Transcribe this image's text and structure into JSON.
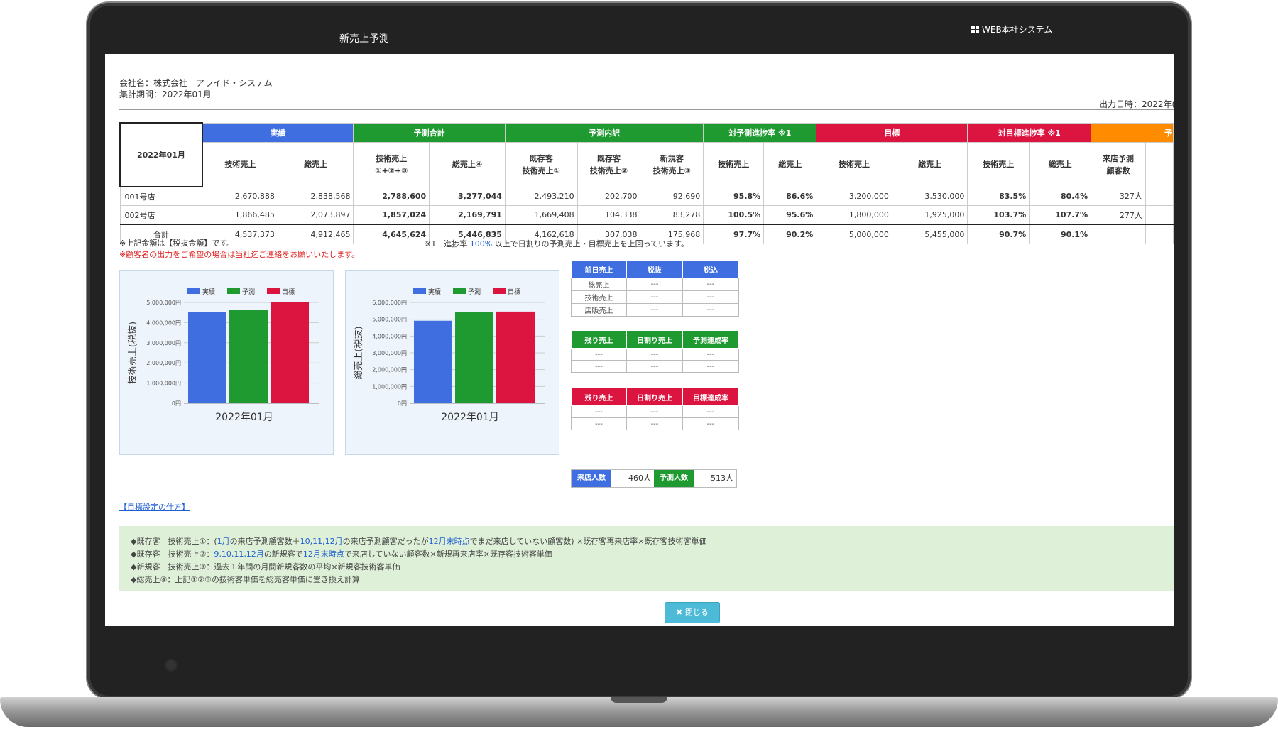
{
  "window": {
    "title": "新売上予測",
    "brand": "WEB本社システム"
  },
  "header": {
    "company": "会社名：株式会社　アライド・システム",
    "period": "集計期間：2022年01月",
    "output_date": "出力日時：2022年("
  },
  "table": {
    "corner": "2022年01月",
    "groups": {
      "actual": "実績",
      "forecast_total": "予測合計",
      "forecast_breakdown": "予測内訳",
      "forecast_progress": "対予測進捗率 ※1",
      "target": "目標",
      "target_progress": "対目標進捗率 ※1",
      "cut": "予"
    },
    "subheaders": {
      "actual_tech": "技術売上",
      "actual_total": "総売上",
      "fc_tech_l1": "技術売上",
      "fc_tech_l2": "①+②+③",
      "fc_total": "総売上④",
      "ex1_l1": "既存客",
      "ex1_l2": "技術売上①",
      "ex2_l1": "既存客",
      "ex2_l2": "技術売上②",
      "new_l1": "新規客",
      "new_l2": "技術売上③",
      "fp_tech": "技術売上",
      "fp_total": "総売上",
      "tg_tech": "技術売上",
      "tg_total": "総売上",
      "tp_tech": "技術売上",
      "tp_total": "総売上",
      "visit_l1": "来店予測",
      "visit_l2": "顧客数"
    },
    "rows": [
      {
        "name": "001号店",
        "a_tech": "2,670,888",
        "a_total": "2,838,568",
        "f_tech": "2,788,600",
        "f_total": "3,277,044",
        "ex1": "2,493,210",
        "ex2": "202,700",
        "new": "92,690",
        "fp_tech": "95.8%",
        "fp_total": "86.6%",
        "t_tech": "3,200,000",
        "t_total": "3,530,000",
        "tp_tech": "83.5%",
        "tp_total": "80.4%",
        "visit": "327人"
      },
      {
        "name": "002号店",
        "a_tech": "1,866,485",
        "a_total": "2,073,897",
        "f_tech": "1,857,024",
        "f_total": "2,169,791",
        "ex1": "1,669,408",
        "ex2": "104,338",
        "new": "83,278",
        "fp_tech": "100.5%",
        "fp_total": "95.6%",
        "t_tech": "1,800,000",
        "t_total": "1,925,000",
        "tp_tech": "103.7%",
        "tp_total": "107.7%",
        "visit": "277人"
      }
    ],
    "total": {
      "name": "合計",
      "a_tech": "4,537,373",
      "a_total": "4,912,465",
      "f_tech": "4,645,624",
      "f_total": "5,446,835",
      "ex1": "4,162,618",
      "ex2": "307,038",
      "new": "175,968",
      "fp_tech": "97.7%",
      "fp_total": "90.2%",
      "t_tech": "5,000,000",
      "t_total": "5,455,000",
      "tp_tech": "90.7%",
      "tp_total": "90.1%",
      "visit": ""
    }
  },
  "notes": {
    "tax": "※上記金額は【税抜金額】です。",
    "customer": "※顧客名の出力をご希望の場合は当社迄ご連絡をお願いいたします。",
    "progress_prefix": "※1　進捗率",
    "progress_pct": "100%",
    "progress_suffix": "以上で日割りの予測売上・目標売上を上回っています。"
  },
  "chart_data": [
    {
      "type": "bar",
      "title": "",
      "ylabel": "技術売上(税抜)",
      "xlabel": "2022年01月",
      "categories": [
        "2022年01月"
      ],
      "ylim": [
        0,
        5000000
      ],
      "yticks": [
        "0円",
        "1,000,000円",
        "2,000,000円",
        "3,000,000円",
        "4,000,000円",
        "5,000,000円"
      ],
      "legend_position": "top",
      "series": [
        {
          "name": "実績",
          "values": [
            4537373
          ],
          "color": "#3f6ee0"
        },
        {
          "name": "予測",
          "values": [
            4645624
          ],
          "color": "#1e9a30"
        },
        {
          "name": "目標",
          "values": [
            5000000
          ],
          "color": "#dc1440"
        }
      ]
    },
    {
      "type": "bar",
      "title": "",
      "ylabel": "総売上(税抜)",
      "xlabel": "2022年01月",
      "categories": [
        "2022年01月"
      ],
      "ylim": [
        0,
        6000000
      ],
      "yticks": [
        "0円",
        "1,000,000円",
        "2,000,000円",
        "3,000,000円",
        "4,000,000円",
        "5,000,000円",
        "6,000,000円"
      ],
      "legend_position": "top",
      "series": [
        {
          "name": "実績",
          "values": [
            4912465
          ],
          "color": "#3f6ee0"
        },
        {
          "name": "予測",
          "values": [
            5446835
          ],
          "color": "#1e9a30"
        },
        {
          "name": "目標",
          "values": [
            5455000
          ],
          "color": "#dc1440"
        }
      ]
    }
  ],
  "summary": {
    "prev_day": {
      "h1": "前日売上",
      "h2": "税抜",
      "h3": "税込",
      "rows": [
        [
          "総売上",
          "---",
          "---"
        ],
        [
          "技術売上",
          "---",
          "---"
        ],
        [
          "店販売上",
          "---",
          "---"
        ]
      ]
    },
    "remain_fc": {
      "h1": "残り売上",
      "h2": "日割り売上",
      "h3": "予測達成率",
      "rows": [
        [
          "---",
          "---",
          "---"
        ],
        [
          "---",
          "---",
          "---"
        ]
      ]
    },
    "remain_tg": {
      "h1": "残り売上",
      "h2": "日割り売上",
      "h3": "目標達成率",
      "rows": [
        [
          "---",
          "---",
          "---"
        ],
        [
          "---",
          "---",
          "---"
        ]
      ]
    },
    "visit_label": "来店人数",
    "visit_value": "460人",
    "forecast_label": "予測人数",
    "forecast_value": "513人"
  },
  "howto_link": "【目標設定の仕方】",
  "explain": {
    "l1_a": "◆既存客　技術売上①：(",
    "l1_b": "1月",
    "l1_c": "の来店予測顧客数＋",
    "l1_d": "10,11,12月",
    "l1_e": "の来店予測顧客だったが",
    "l1_f": "12月末時点",
    "l1_g": "でまだ来店していない顧客数) ×既存客再来店率×既存客技術客単価",
    "l2_a": "◆既存客　技術売上②：",
    "l2_b": "9,10,11,12月",
    "l2_c": "の新規客で",
    "l2_d": "12月末時点",
    "l2_e": "で来店していない顧客数×新規再来店率×既存客技術客単価",
    "l3": "◆新規客　技術売上③：過去１年間の月間新規客数の平均×新規客技術客単価",
    "l4": "◆総売上④：上記①②③の技術客単価を総売客単価に置き換え計算"
  },
  "close_button": "✖ 閉じる"
}
